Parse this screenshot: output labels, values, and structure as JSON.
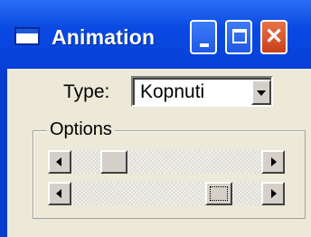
{
  "window": {
    "title": "Animation",
    "minimize_icon": "minimize-icon",
    "maximize_icon": "maximize-icon",
    "close_icon": "close-icon",
    "close_glyph": "✕"
  },
  "type_field": {
    "label": "Type:",
    "selected_value": "Kopnuti"
  },
  "options_group": {
    "label": "Options",
    "scrollbars": [
      {
        "level": 0.18,
        "focused": false
      },
      {
        "level": 0.82,
        "focused": true
      }
    ]
  },
  "colors": {
    "titlebar": "#0a4ae2",
    "close_button": "#c8401a",
    "client_bg": "#ece9d8"
  }
}
